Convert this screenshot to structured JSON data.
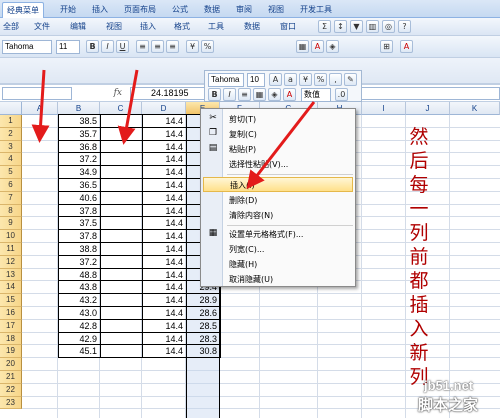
{
  "ribbon": {
    "tabs": [
      "经典菜单",
      "开始",
      "插入",
      "页面布局",
      "公式",
      "数据",
      "审阅",
      "视图",
      "开发工具"
    ],
    "menus": [
      "全部",
      "文件",
      "编辑",
      "视图",
      "插入",
      "格式",
      "工具",
      "数据",
      "窗口"
    ],
    "font_name": "Tahoma",
    "font_size": "11"
  },
  "mini_toolbar": {
    "font_name": "Tahoma",
    "font_size": "10",
    "format_label": "数值"
  },
  "formula_bar": {
    "fx": "fx",
    "value": "24.18195"
  },
  "grid": {
    "columns": [
      "A",
      "B",
      "C",
      "D",
      "E",
      "F",
      "G",
      "H",
      "I",
      "J",
      "K"
    ],
    "rows": [
      "1",
      "2",
      "3",
      "4",
      "5",
      "6",
      "7",
      "8",
      "9",
      "10",
      "11",
      "12",
      "13",
      "14",
      "15",
      "16",
      "17",
      "18",
      "19",
      "20",
      "21",
      "22",
      "23"
    ],
    "col_b": [
      "38.5",
      "35.7",
      "36.8",
      "37.2",
      "34.9",
      "36.5",
      "40.6",
      "37.8",
      "37.5",
      "37.8",
      "38.8",
      "37.2",
      "48.8",
      "43.8",
      "43.2",
      "43.0",
      "42.8",
      "42.9",
      "45.1"
    ],
    "col_d": [
      "14.4",
      "14.4",
      "14.4",
      "14.4",
      "14.4",
      "14.4",
      "14.4",
      "14.4",
      "14.4",
      "14.4",
      "14.4",
      "14.4",
      "14.4",
      "14.4",
      "14.4",
      "14.4",
      "14.4",
      "14.4",
      "14.4"
    ],
    "col_e_visible": [
      "29.4",
      "28.9",
      "28.6",
      "28.5",
      "28.3",
      "30.8"
    ]
  },
  "context_menu": {
    "items": [
      "剪切(T)",
      "复制(C)",
      "粘贴(P)",
      "选择性粘贴(V)...",
      "插入(I)",
      "删除(D)",
      "清除内容(N)",
      "设置单元格格式(F)...",
      "列宽(C)...",
      "隐藏(H)",
      "取消隐藏(U)"
    ]
  },
  "annotation": {
    "text": [
      "然",
      "后",
      "每",
      "一",
      "列",
      "前",
      "都",
      "插",
      "入",
      "新",
      "列"
    ],
    "color": "#b00000"
  },
  "watermark": {
    "line1": "jb51.net",
    "line2": "脚本之家"
  }
}
